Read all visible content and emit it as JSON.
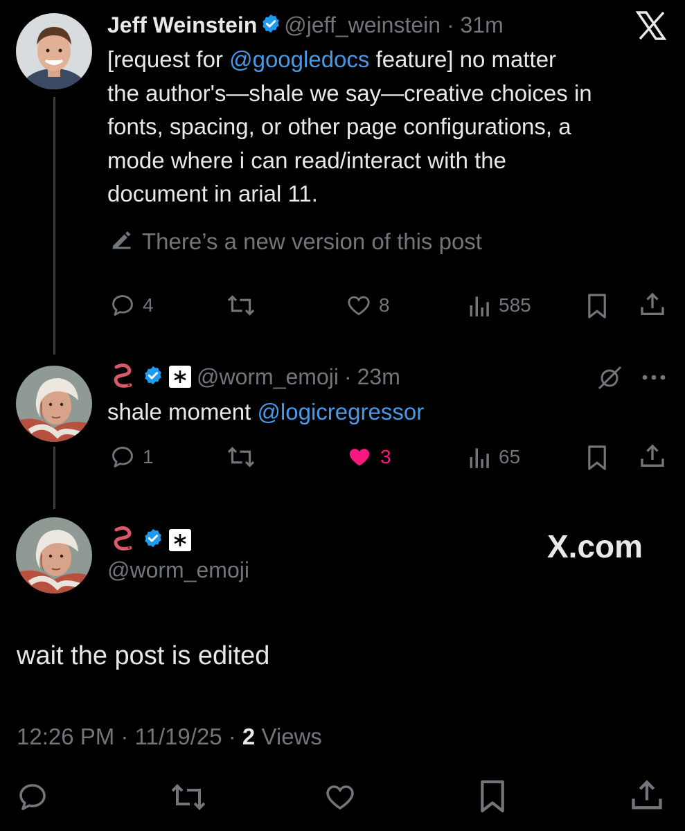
{
  "post1": {
    "name": "Jeff Weinstein",
    "handle": "@jeff_weinstein",
    "time": "31m",
    "text_prefix": "[request for ",
    "mention": "@googledocs",
    "text_line1_rest": " feature] no matter",
    "text_line2": "the author's—shale we say—creative choices in",
    "text_line3": "fonts, spacing, or other page configurations, a",
    "text_line4": "mode where i can read/interact with the",
    "text_line5": "document in arial 11.",
    "edit_notice": "There’s a new version of this post",
    "replies": "4",
    "likes": "8",
    "views": "585"
  },
  "post2": {
    "handle": "@worm_emoji",
    "time": "23m",
    "text": "shale moment ",
    "mention": "@logicregressor",
    "replies": "1",
    "likes": "3",
    "views": "65"
  },
  "post3": {
    "handle": "@worm_emoji",
    "brand": "X.com",
    "text": "wait the post is edited",
    "timestamp": "12:26 PM · 11/19/25 · ",
    "views_count": "2",
    "views_label": " Views"
  },
  "colors": {
    "accent": "#4a99e9",
    "like": "#f91880",
    "muted": "#71767b",
    "verified": "#1d9bf0"
  }
}
